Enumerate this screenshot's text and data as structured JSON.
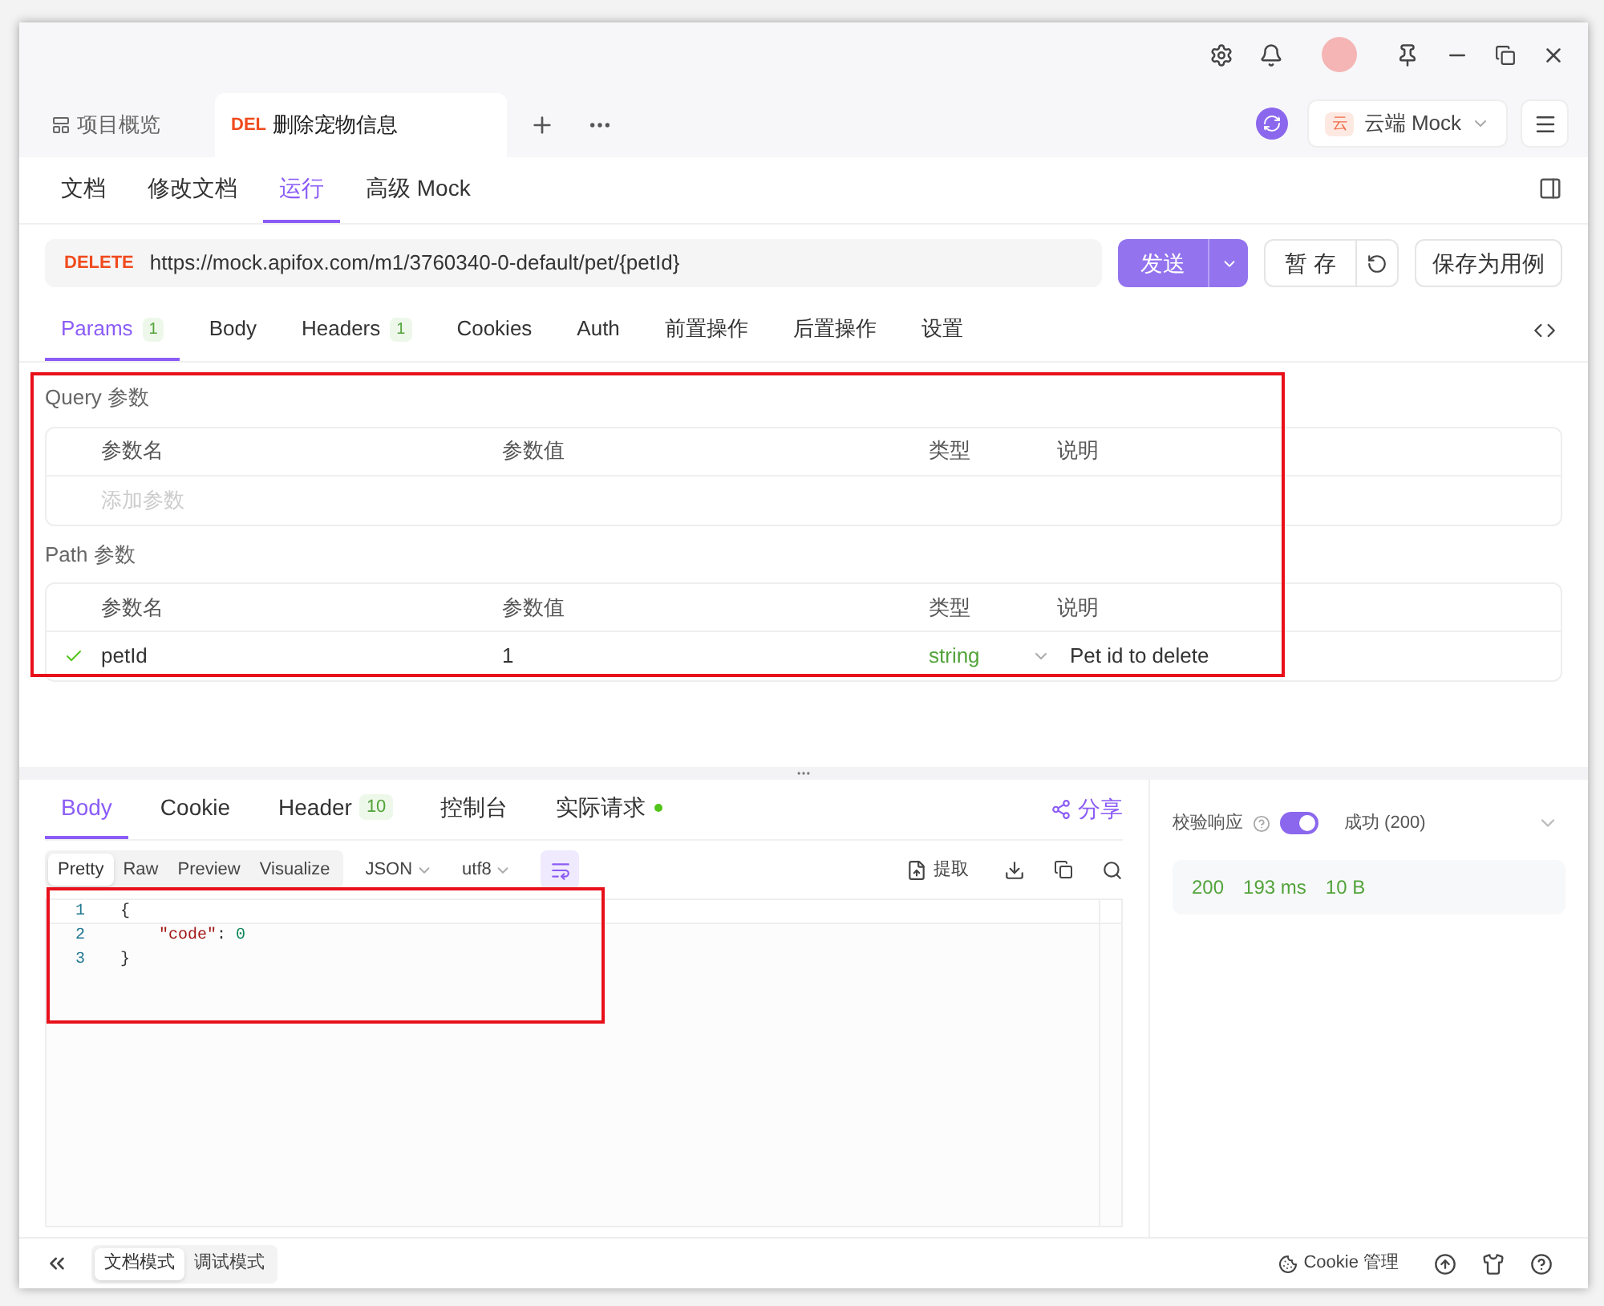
{
  "doc_tabs": [
    {
      "kind": "overview",
      "label": "项目概览",
      "selected": false
    },
    {
      "kind": "endpoint",
      "method": "DEL",
      "label": "删除宠物信息",
      "selected": true
    }
  ],
  "environment": {
    "badge": "云",
    "label": "云端 Mock"
  },
  "view_tabs": [
    {
      "label": "文档",
      "selected": false
    },
    {
      "label": "修改文档",
      "selected": false
    },
    {
      "label": "运行",
      "selected": true
    },
    {
      "label": "高级 Mock",
      "selected": false
    }
  ],
  "request": {
    "method": "DELETE",
    "url": "https://mock.apifox.com/m1/3760340-0-default/pet/{petId}",
    "send": "发送",
    "save": "暂 存",
    "save_case": "保存为用例"
  },
  "param_tabs": [
    {
      "label": "Params",
      "count": "1",
      "selected": true
    },
    {
      "label": "Body",
      "selected": false
    },
    {
      "label": "Headers",
      "count": "1",
      "selected": false
    },
    {
      "label": "Cookies",
      "selected": false
    },
    {
      "label": "Auth",
      "selected": false
    },
    {
      "label": "前置操作",
      "selected": false
    },
    {
      "label": "后置操作",
      "selected": false
    },
    {
      "label": "设置",
      "selected": false
    }
  ],
  "query_params": {
    "title": "Query 参数",
    "columns": [
      "参数名",
      "参数值",
      "类型",
      "说明"
    ],
    "placeholder": "添加参数"
  },
  "path_params": {
    "title": "Path 参数",
    "columns": [
      "参数名",
      "参数值",
      "类型",
      "说明"
    ],
    "rows": [
      {
        "checked": true,
        "name": "petId",
        "value": "1",
        "type": "string",
        "description": "Pet id to delete"
      }
    ]
  },
  "response_tabs": [
    {
      "label": "Body",
      "selected": true
    },
    {
      "label": "Cookie",
      "selected": false
    },
    {
      "label": "Header",
      "count": "10",
      "selected": false
    },
    {
      "label": "控制台",
      "selected": false
    },
    {
      "label": "实际请求",
      "dot": true,
      "selected": false
    }
  ],
  "share": "分享",
  "view_modes": [
    {
      "label": "Pretty",
      "selected": true
    },
    {
      "label": "Raw",
      "selected": false
    },
    {
      "label": "Preview",
      "selected": false
    },
    {
      "label": "Visualize",
      "selected": false
    }
  ],
  "format": "JSON",
  "encoding": "utf8",
  "wrap_on": true,
  "extract": "提取",
  "code_lines": [
    {
      "number": "1",
      "indented": false,
      "tokens": [
        {
          "kind": "punct",
          "text": "{"
        }
      ]
    },
    {
      "number": "2",
      "indented": true,
      "tokens": [
        {
          "kind": "key",
          "text": "\"code\""
        },
        {
          "kind": "punct",
          "text": ": "
        },
        {
          "kind": "number",
          "text": "0"
        }
      ]
    },
    {
      "number": "3",
      "indented": false,
      "tokens": [
        {
          "kind": "punct",
          "text": "}"
        }
      ]
    }
  ],
  "validation": {
    "label": "校验响应",
    "on": true,
    "status": "成功 (200)",
    "stats": [
      "200",
      "193 ms",
      "10 B"
    ]
  },
  "modes": [
    {
      "label": "文档模式",
      "selected": true
    },
    {
      "label": "调试模式",
      "selected": false
    }
  ],
  "cookie_manager": "Cookie 管理"
}
